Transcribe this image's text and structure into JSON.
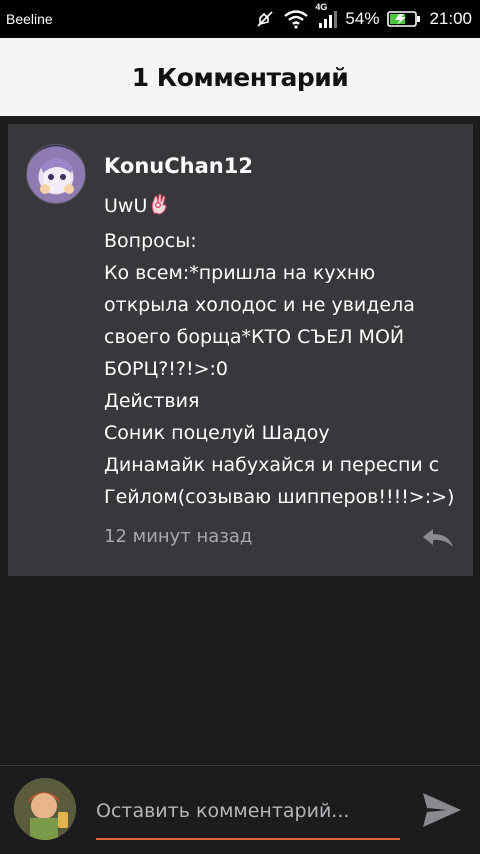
{
  "status_bar": {
    "carrier": "Beeline",
    "network": "4G",
    "battery": "54%",
    "time": "21:00",
    "icons": [
      "mute-icon",
      "wifi-icon",
      "signal-icon",
      "battery-charging-icon"
    ]
  },
  "header": {
    "title": "1 Комментарий"
  },
  "comment": {
    "username": "KonuChan12",
    "lines": [
      "UwU",
      "Вопросы:",
      "Ко всем:*пришла на кухню",
      "открыла холодос и не увидела",
      "своего борща*КТО СЪЕЛ МОЙ",
      "БОРЦ?!?!>:0",
      "Действия",
      "Соник поцелуй Шадоу",
      "Динамайк набухайся и переспи с",
      "Гейлом(созываю шипперов!!!!>:>)"
    ],
    "time": "12 минут назад",
    "icons": [
      "ok-hand-emoji",
      "reply-icon"
    ]
  },
  "input": {
    "placeholder": "Оставить комментарий...",
    "value": "",
    "icons": [
      "send-icon"
    ]
  },
  "colors": {
    "background": "#1c1b1e",
    "card": "#38373b",
    "header": "#f5f5f5",
    "accent": "#e2643c",
    "muted_text": "#a8a7ab"
  }
}
